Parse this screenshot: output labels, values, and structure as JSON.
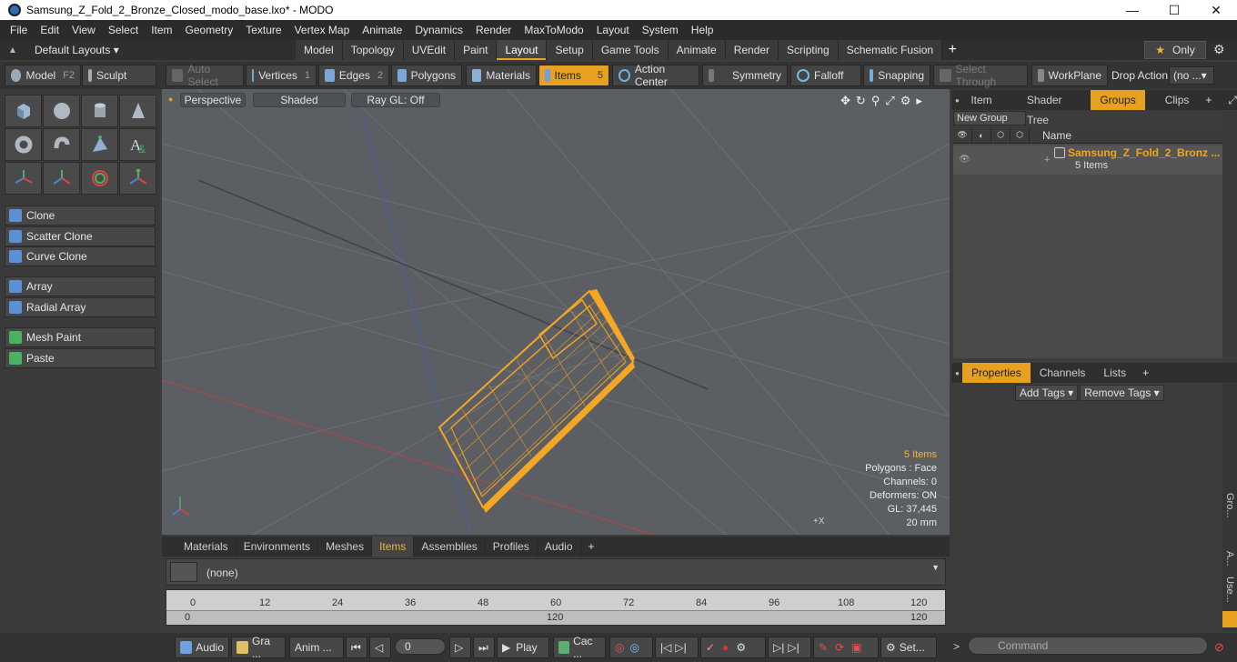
{
  "window": {
    "title": "Samsung_Z_Fold_2_Bronze_Closed_modo_base.lxo* - MODO",
    "minimize": "—",
    "maximize": "☐",
    "close": "✕"
  },
  "menu": [
    "File",
    "Edit",
    "View",
    "Select",
    "Item",
    "Geometry",
    "Texture",
    "Vertex Map",
    "Animate",
    "Dynamics",
    "Render",
    "MaxToModo",
    "Layout",
    "System",
    "Help"
  ],
  "layoutbar": {
    "default_layouts": "Default Layouts ▾",
    "tabs": [
      "Model",
      "Topology",
      "UVEdit",
      "Paint",
      "Layout",
      "Setup",
      "Game Tools",
      "Animate",
      "Render",
      "Scripting",
      "Schematic Fusion"
    ],
    "active_tab": "Layout",
    "add": "+",
    "only_label": "Only"
  },
  "toolbar": {
    "model": "Model",
    "model_key": "F2",
    "sculpt": "Sculpt",
    "auto_select": "Auto Select",
    "vertices": "Vertices",
    "vertices_count": "1",
    "edges": "Edges",
    "edges_count": "2",
    "polygons": "Polygons",
    "materials": "Materials",
    "items": "Items",
    "items_count": "5",
    "action_center": "Action Center",
    "symmetry": "Symmetry",
    "falloff": "Falloff",
    "snapping": "Snapping",
    "select_through": "Select Through",
    "workplane": "WorkPlane",
    "drop_action": "Drop Action",
    "drop_value": "(no ...▾"
  },
  "tools": {
    "clone": "Clone",
    "scatter_clone": "Scatter Clone",
    "curve_clone": "Curve Clone",
    "array": "Array",
    "radial_array": "Radial Array",
    "mesh_paint": "Mesh Paint",
    "paste": "Paste"
  },
  "viewport": {
    "view": "Perspective",
    "shading": "Shaded",
    "raygl": "Ray GL: Off",
    "stats": {
      "items": "5 Items",
      "polygons": "Polygons : Face",
      "channels": "Channels: 0",
      "deformers": "Deformers: ON",
      "gl": "GL: 37,445",
      "unit": "20 mm"
    },
    "axis_label": "+X"
  },
  "right_top": {
    "tabs": [
      "Item List",
      "Shader Tree",
      "Groups",
      "Clips"
    ],
    "active": "Groups",
    "new_group": "New Group",
    "name_header": "Name",
    "group_name": "Samsung_Z_Fold_2_Bronz ...",
    "group_count": "5 Items"
  },
  "right_bottom": {
    "tabs": [
      "Properties",
      "Channels",
      "Lists"
    ],
    "active": "Properties",
    "add_tags": "Add Tags ▾",
    "remove_tags": "Remove Tags ▾",
    "side_labels": [
      "Gro...",
      "A...",
      "Use..."
    ]
  },
  "bottom": {
    "tabs": [
      "Materials",
      "Environments",
      "Meshes",
      "Items",
      "Assemblies",
      "Profiles",
      "Audio"
    ],
    "active": "Items",
    "item_value": "(none)",
    "ticks": [
      "0",
      "12",
      "24",
      "36",
      "48",
      "60",
      "72",
      "84",
      "96",
      "108",
      "120"
    ],
    "range_start": "0",
    "range_mid": "120",
    "range_end": "120"
  },
  "status": {
    "audio": "Audio",
    "graph": "Gra ...",
    "anim": "Anim ...",
    "frame": "0",
    "play": "Play",
    "cache": "Cac ...",
    "settings": "Set...",
    "command_placeholder": "Command"
  },
  "colors": {
    "accent": "#e8a020",
    "wire": "#f5a623"
  }
}
